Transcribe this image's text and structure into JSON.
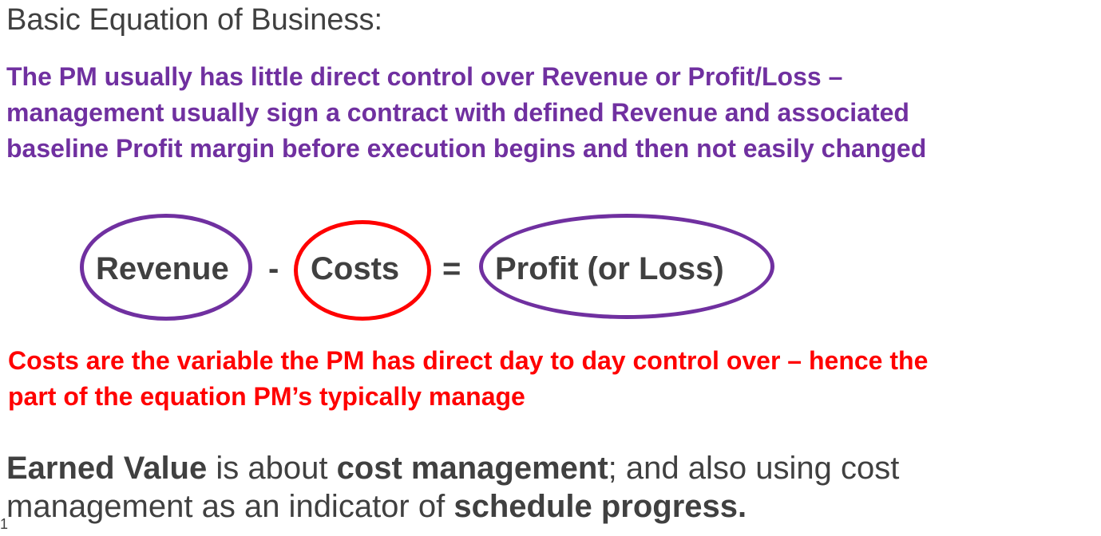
{
  "heading": "Basic Equation of Business:",
  "purple_note": {
    "lines": [
      "The PM  usually has little direct control over Revenue or Profit/Loss –",
      "management usually sign a contract with defined Revenue and associated",
      "baseline Profit margin before execution begins and then not easily changed"
    ]
  },
  "equation": {
    "revenue": "Revenue",
    "minus": "-",
    "costs": "Costs",
    "equals": "=",
    "profit": "Profit (or Loss)",
    "colors": {
      "revenue_ellipse": "#7030a0",
      "costs_ellipse": "#ff0000",
      "profit_ellipse": "#7030a0"
    }
  },
  "red_note": {
    "lines": [
      "Costs are the variable the PM has direct day to day control over – hence the",
      "part of the equation PM’s typically manage"
    ]
  },
  "earned_value": {
    "line1": {
      "bold1": "Earned Value",
      "text1": " is about ",
      "bold2": "cost management",
      "text2": "; and also using cost"
    },
    "line2": {
      "text1": "management as an indicator of ",
      "bold1": "schedule progress."
    }
  },
  "slide_number": "1",
  "colors": {
    "purple": "#7030a0",
    "red": "#ff0000",
    "text": "#404040"
  }
}
